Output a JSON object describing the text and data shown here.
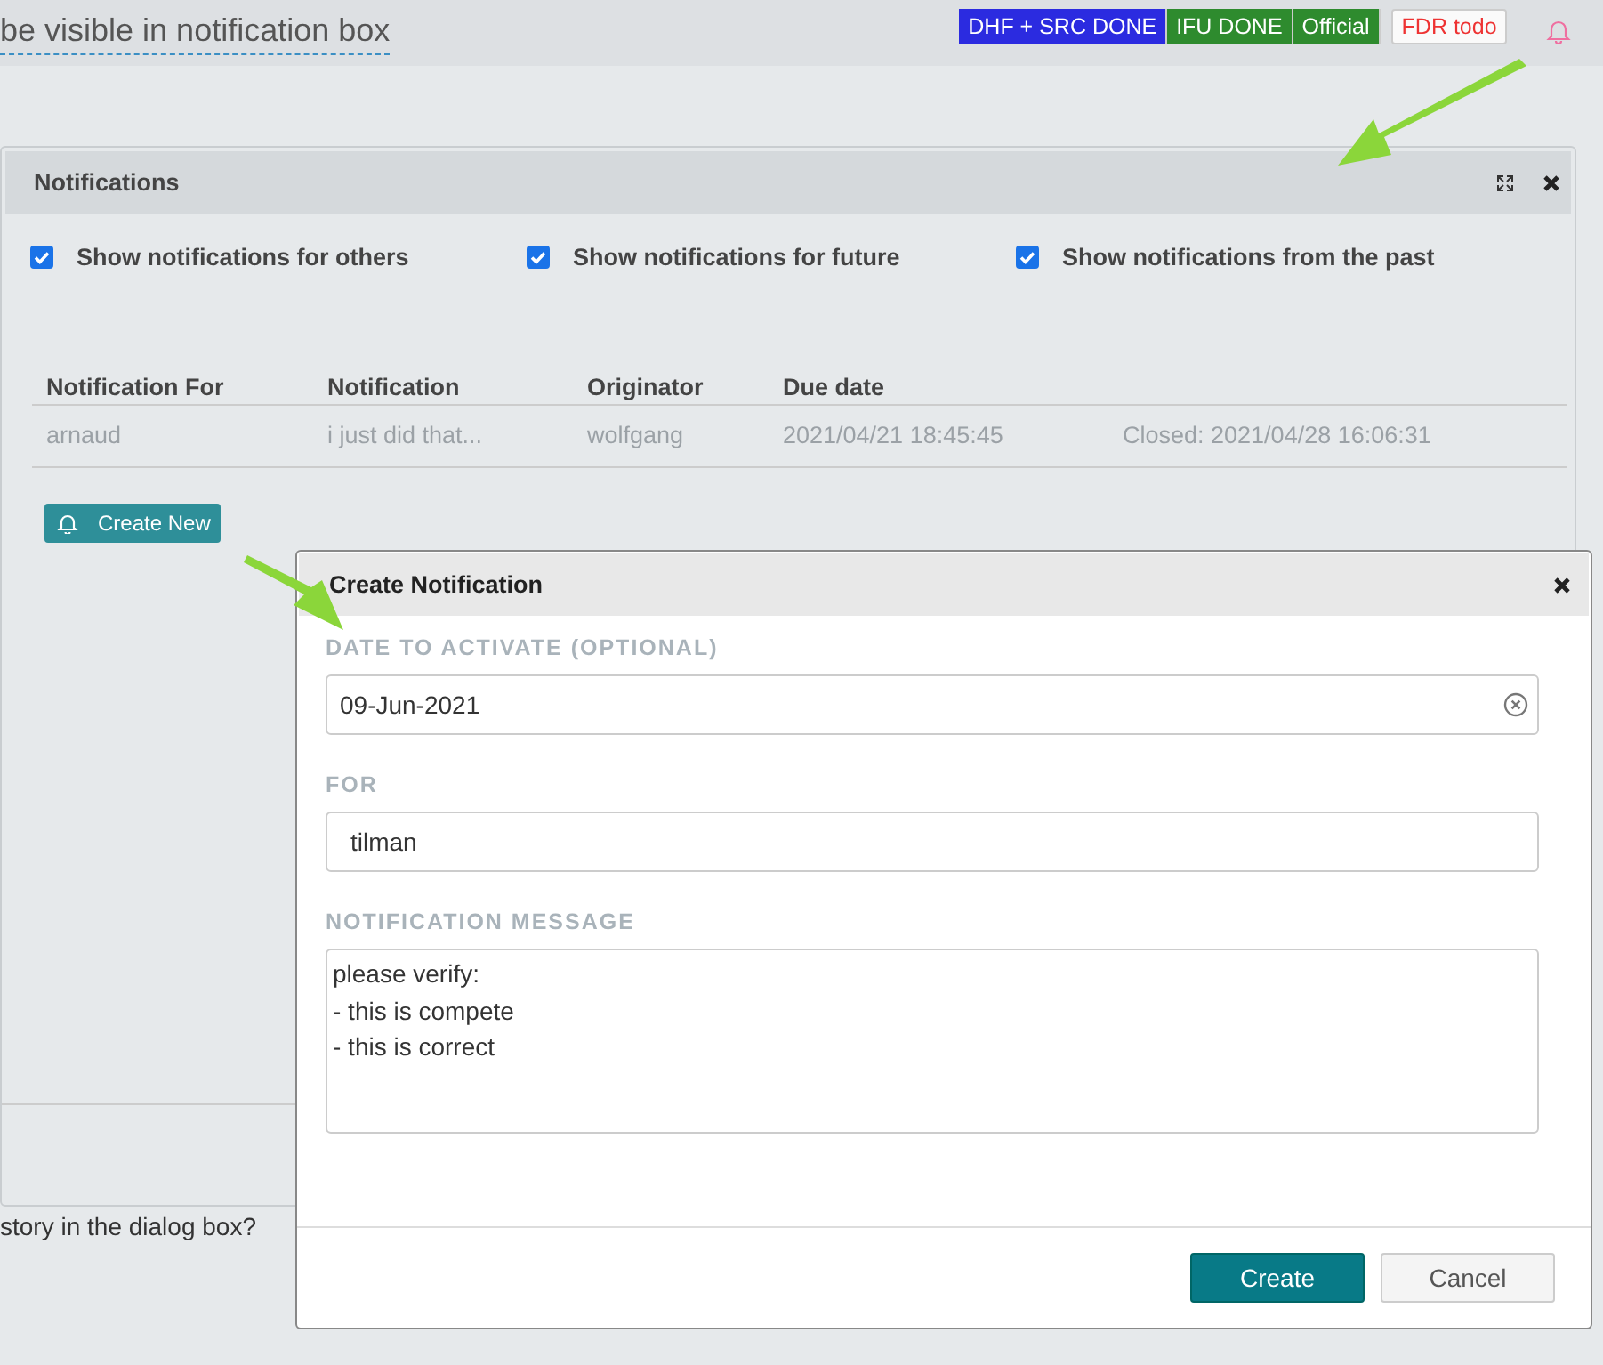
{
  "topbar": {
    "title": "be visible in notification box",
    "badges": [
      {
        "label": "DHF + SRC DONE",
        "color": "#2b2be0"
      },
      {
        "label": "IFU DONE",
        "color": "#2e8b2e"
      },
      {
        "label": "Official",
        "color": "#2e8b2e"
      }
    ],
    "todo_badge": "FDR todo"
  },
  "notifications_panel": {
    "title": "Notifications",
    "filters": [
      {
        "label": "Show notifications for others",
        "checked": true
      },
      {
        "label": "Show notifications for future",
        "checked": true
      },
      {
        "label": "Show notifications from the past",
        "checked": true
      }
    ],
    "table": {
      "columns": [
        "Notification For",
        "Notification",
        "Originator",
        "Due date"
      ],
      "rows": [
        {
          "cells": [
            "arnaud",
            "i just did that...",
            "wolfgang",
            "2021/04/21 18:45:45",
            "Closed: 2021/04/28 16:06:31"
          ],
          "closed": true
        }
      ]
    },
    "create_button": "Create New"
  },
  "background_text": "story in the dialog box?",
  "dialog": {
    "title": "Create Notification",
    "fields": [
      {
        "kind": "date",
        "label": "DATE TO ACTIVATE (OPTIONAL)",
        "value": "09-Jun-2021"
      },
      {
        "kind": "text",
        "label": "FOR",
        "value": "tilman"
      },
      {
        "kind": "textarea",
        "label": "NOTIFICATION MESSAGE",
        "value": "please verify:\n- this is compete\n- this is correct"
      }
    ],
    "buttons": [
      {
        "label": "Create",
        "kind": "primary"
      },
      {
        "label": "Cancel",
        "kind": "secondary"
      }
    ]
  }
}
